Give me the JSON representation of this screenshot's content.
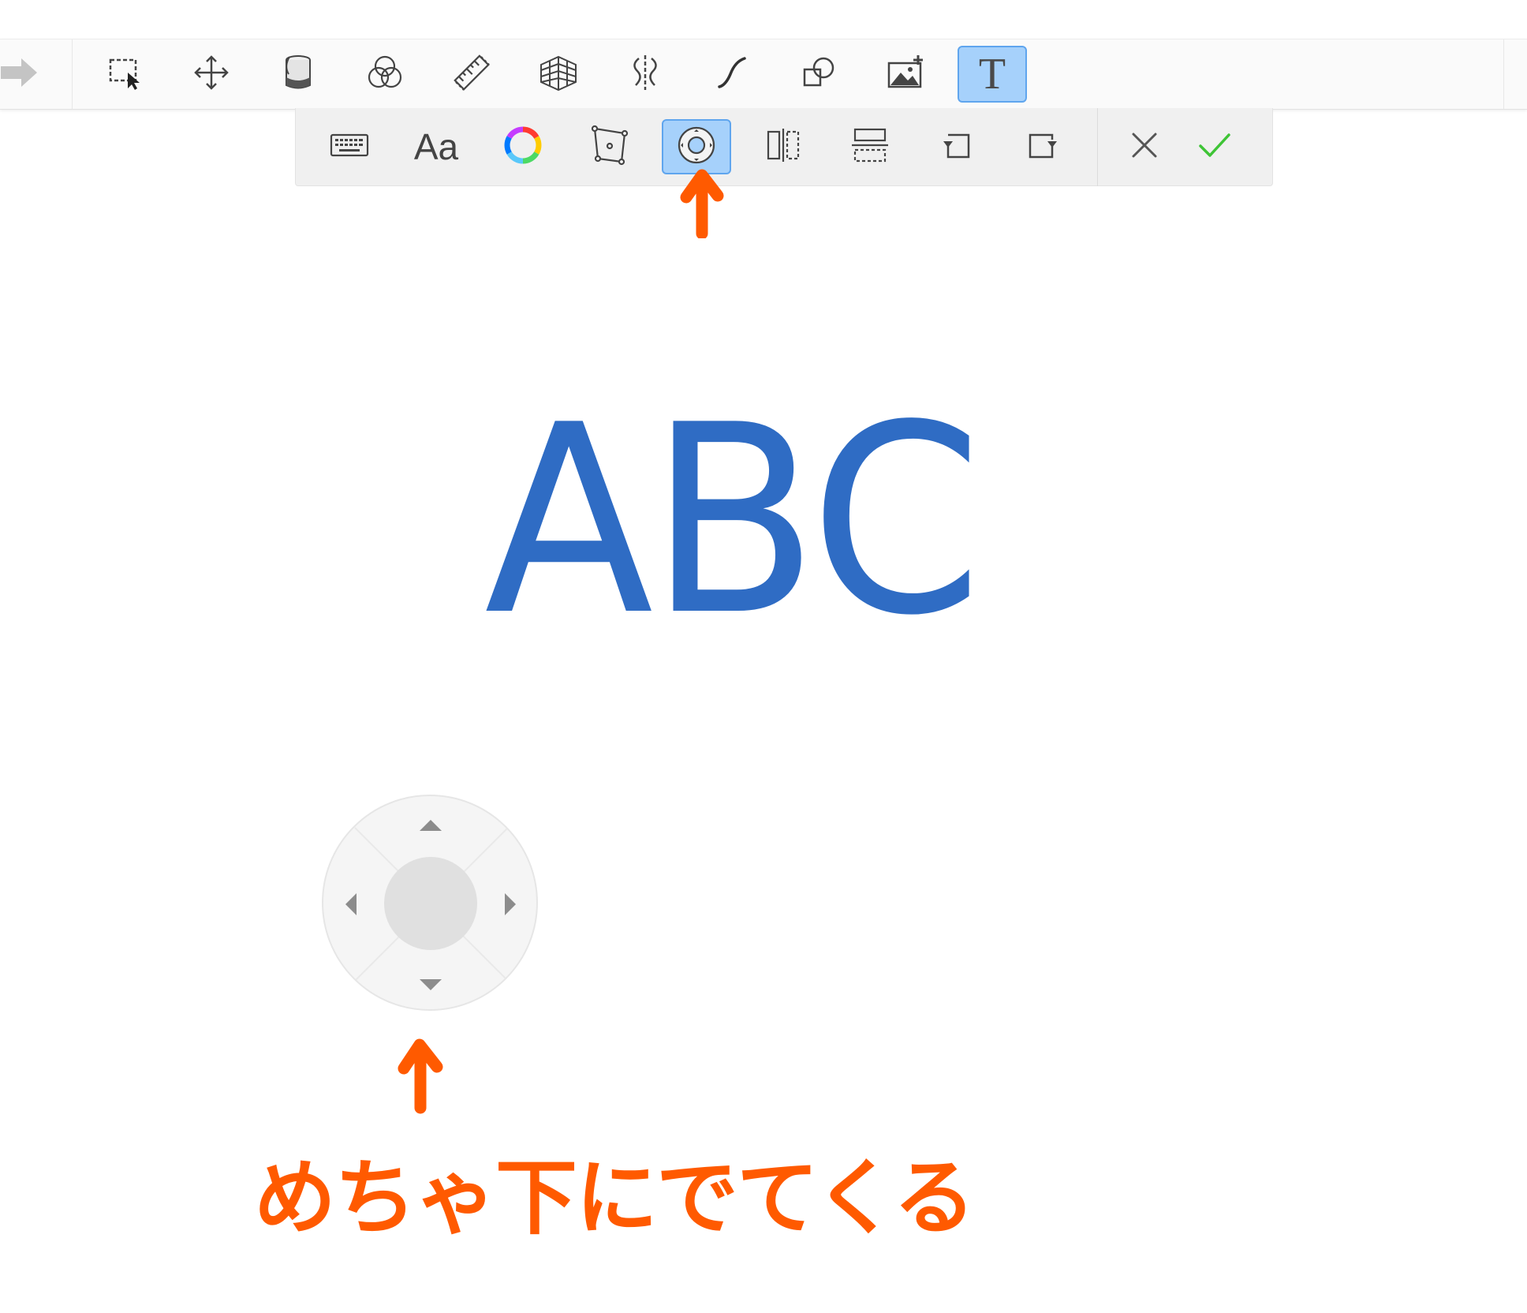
{
  "main_toolbar": {
    "tools": [
      {
        "id": "redo",
        "icon": "redo-arrow-icon"
      },
      {
        "id": "selection",
        "icon": "selection-icon"
      },
      {
        "id": "transform",
        "icon": "move-icon"
      },
      {
        "id": "fill",
        "icon": "paint-bucket-icon"
      },
      {
        "id": "blend",
        "icon": "color-circles-icon"
      },
      {
        "id": "ruler",
        "icon": "ruler-icon"
      },
      {
        "id": "perspective",
        "icon": "perspective-grid-icon"
      },
      {
        "id": "symmetry",
        "icon": "symmetry-icon"
      },
      {
        "id": "stroke",
        "icon": "curve-icon"
      },
      {
        "id": "shape",
        "icon": "shapes-icon"
      },
      {
        "id": "image",
        "icon": "add-image-icon"
      },
      {
        "id": "text",
        "icon": "text-tool-icon",
        "label": "T",
        "active": true
      }
    ]
  },
  "text_toolbar": {
    "tools": [
      {
        "id": "keyboard",
        "icon": "keyboard-icon"
      },
      {
        "id": "font",
        "icon": "font-icon",
        "label": "Aa"
      },
      {
        "id": "color",
        "icon": "color-wheel-icon"
      },
      {
        "id": "distort",
        "icon": "distort-icon"
      },
      {
        "id": "nudge",
        "icon": "nudge-joystick-icon",
        "active": true
      },
      {
        "id": "flip_h",
        "icon": "flip-horizontal-icon"
      },
      {
        "id": "flip_v",
        "icon": "flip-vertical-icon"
      },
      {
        "id": "rotate_left",
        "icon": "rotate-left-icon"
      },
      {
        "id": "rotate_right",
        "icon": "rotate-right-icon"
      },
      {
        "id": "cancel",
        "icon": "close-icon"
      },
      {
        "id": "confirm",
        "icon": "checkmark-icon"
      }
    ]
  },
  "canvas": {
    "text": "ABC",
    "text_color": "#2f6cc4"
  },
  "joystick": {
    "arrows": [
      "up",
      "down",
      "left",
      "right"
    ]
  },
  "annotation": {
    "text": "めちゃ下にでてくる",
    "color": "#ff5a00"
  },
  "colors": {
    "accent": "#a6d1fb",
    "accent_border": "#5fa5ee",
    "confirm": "#3ec436",
    "icon": "#4a4a4a"
  }
}
